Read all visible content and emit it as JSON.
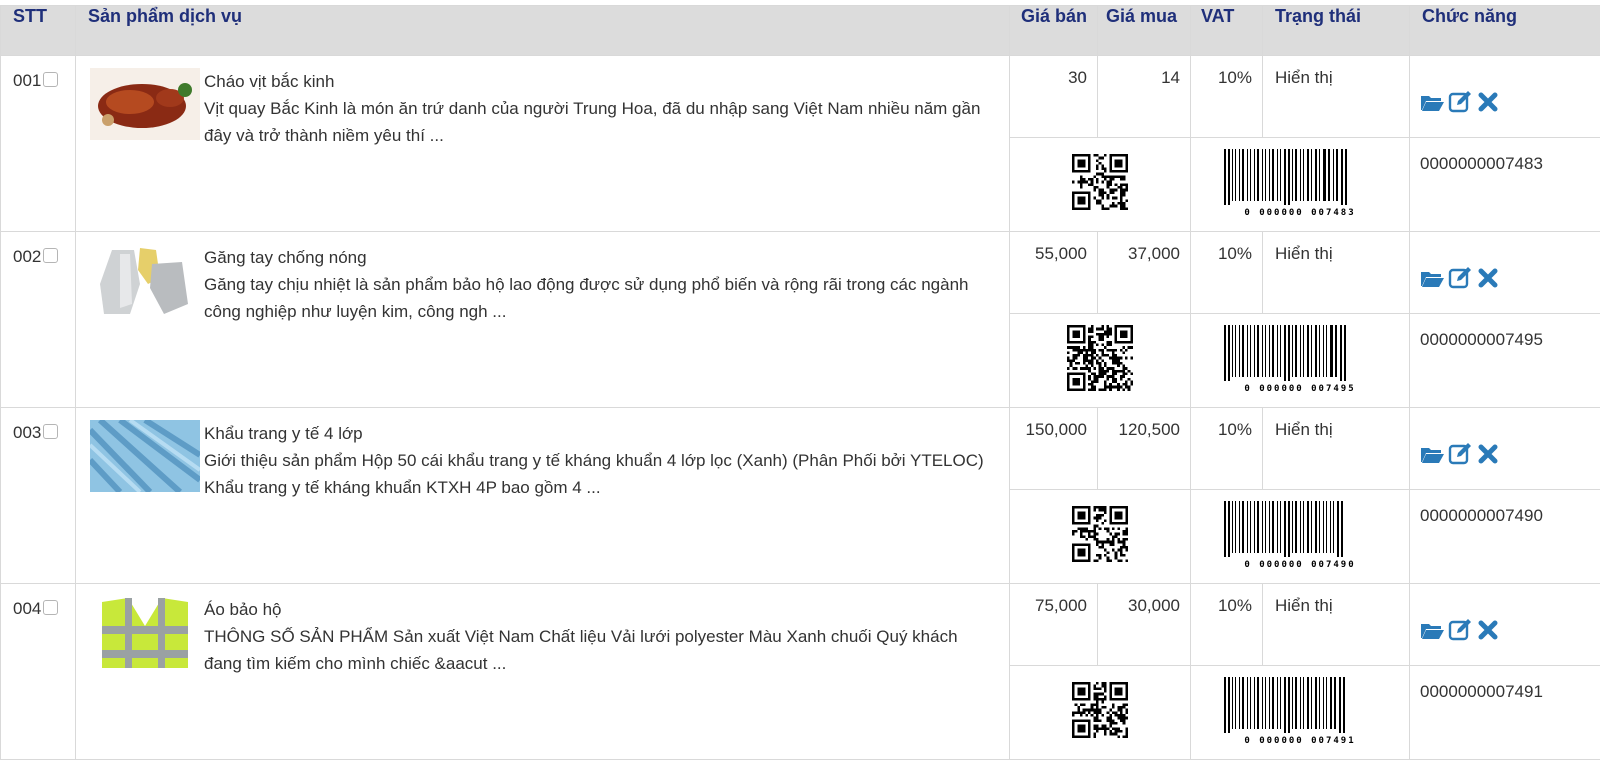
{
  "headers": {
    "stt": "STT",
    "product": "Sản phẩm dịch vụ",
    "sale_price": "Giá bán",
    "buy_price": "Giá mua",
    "vat": "VAT",
    "status": "Trạng thái",
    "functions": "Chức năng"
  },
  "icons": {
    "open": "folder-open-icon",
    "edit": "edit-icon",
    "delete": "close-icon"
  },
  "colors": {
    "header_bg": "#dcdcdc",
    "header_text": "#1f2f7a",
    "action_icon": "#2a7ab8"
  },
  "rows": [
    {
      "stt": "001",
      "name": "Cháo vịt bắc kinh",
      "desc": "Vịt quay Bắc Kinh là món ăn trứ danh của người Trung Hoa, đã du nhập sang Việt Nam nhiều năm gần đây và trở thành niềm yêu thí ...",
      "sale": "30",
      "buy": "14",
      "vat": "10%",
      "status": "Hiển thị",
      "code": "0000000007483",
      "barcode_text": "0 000000 007483"
    },
    {
      "stt": "002",
      "name": "Găng tay chống nóng",
      "desc": "Găng tay chịu nhiệt là sản phẩm bảo hộ lao động được sử dụng phổ biến và rộng rãi trong các ngành công nghiệp như luyện kim, công ngh ...",
      "sale": "55,000",
      "buy": "37,000",
      "vat": "10%",
      "status": "Hiển thị",
      "code": "0000000007495",
      "barcode_text": "0 000000 007495"
    },
    {
      "stt": "003",
      "name": "Khẩu trang y tế 4 lớp",
      "desc": "  Giới thiệu sản phẩm Hộp 50 cái khẩu trang y tế kháng khuẩn 4 lớp lọc (Xanh) (Phân Phối bởi YTELOC) Khẩu trang y tế kháng khuẩn KTXH 4P bao gồm 4 ...",
      "sale": "150,000",
      "buy": "120,500",
      "vat": "10%",
      "status": "Hiển thị",
      "code": "0000000007490",
      "barcode_text": "0 000000 007490"
    },
    {
      "stt": "004",
      "name": "Áo bảo hộ",
      "desc": "THÔNG SỐ SẢN PHẨM Sản xuất Việt Nam Chất liệu Vải lưới polyester Màu Xanh chuối Quý khách đang tìm kiếm cho mình chiếc &aacut ...",
      "sale": "75,000",
      "buy": "30,000",
      "vat": "10%",
      "status": "Hiển thị",
      "code": "0000000007491",
      "barcode_text": "0 000000 007491"
    }
  ]
}
